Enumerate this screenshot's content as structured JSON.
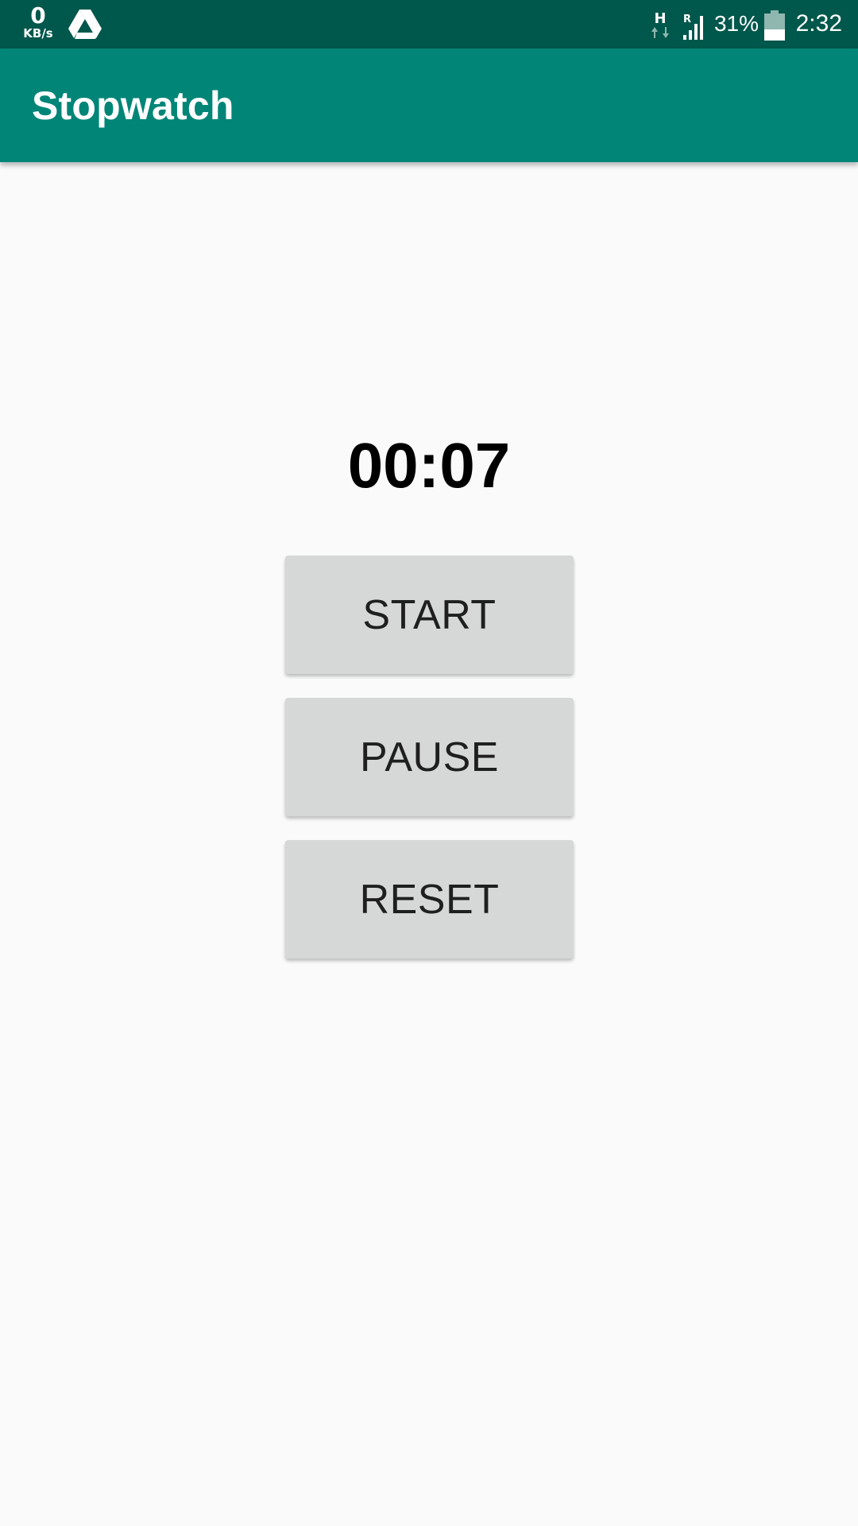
{
  "status_bar": {
    "net_speed_value": "0",
    "net_speed_unit": "KB/s",
    "network_type": "H",
    "roaming": "R",
    "battery_percent": "31%",
    "time": "2:32",
    "icons": [
      "net-speed-indicator",
      "google-drive-icon",
      "hspa-data-icon",
      "signal-roaming-icon",
      "battery-icon"
    ]
  },
  "app_bar": {
    "title": "Stopwatch",
    "color": "#008577",
    "status_color": "#00574b"
  },
  "stopwatch": {
    "time": "00:07"
  },
  "buttons": {
    "start_label": "START",
    "pause_label": "PAUSE",
    "reset_label": "RESET"
  }
}
